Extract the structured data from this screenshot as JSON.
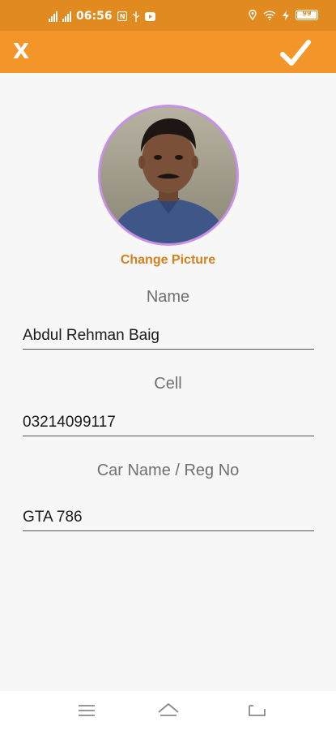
{
  "status_bar": {
    "time": "06:56",
    "network_label_1": "4G",
    "network_label_2": "4G",
    "battery": "99"
  },
  "toolbar": {
    "close_label": "X"
  },
  "profile": {
    "change_picture_label": "Change Picture"
  },
  "form": {
    "name_label": "Name",
    "name_value": "Abdul Rehman Baig",
    "cell_label": "Cell",
    "cell_value": "03214099117",
    "car_label": "Car Name / Reg No",
    "car_value": "GTA 786"
  },
  "colors": {
    "status_bar": "#e08a1f",
    "app_bar": "#f4952a",
    "accent_text": "#d4801c",
    "avatar_ring": "#c890e8"
  },
  "icons": {
    "close": "close-icon",
    "confirm": "checkmark-icon",
    "menu": "menu-icon",
    "home": "home-icon",
    "back": "back-icon"
  }
}
